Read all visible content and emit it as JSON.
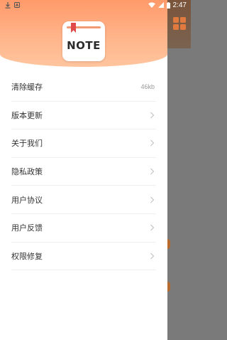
{
  "status_bar": {
    "time": "2:47",
    "icons": [
      "download-icon",
      "notification-icon",
      "wifi-icon",
      "cellular-icon",
      "battery-icon"
    ]
  },
  "drawer": {
    "logo_text": "NOTE",
    "menu": [
      {
        "label": "清除缓存",
        "value": "46kb",
        "trailing": "value"
      },
      {
        "label": "版本更新",
        "trailing": "chevron"
      },
      {
        "label": "关于我们",
        "trailing": "chevron"
      },
      {
        "label": "隐私政策",
        "trailing": "chevron"
      },
      {
        "label": "用户协议",
        "trailing": "chevron"
      },
      {
        "label": "用户反馈",
        "trailing": "chevron"
      },
      {
        "label": "权限修复",
        "trailing": "chevron"
      }
    ]
  },
  "colors": {
    "header_gradient_top": "#ff9a6a",
    "header_gradient_bottom": "#ffc59e",
    "accent": "#e07a3e"
  }
}
